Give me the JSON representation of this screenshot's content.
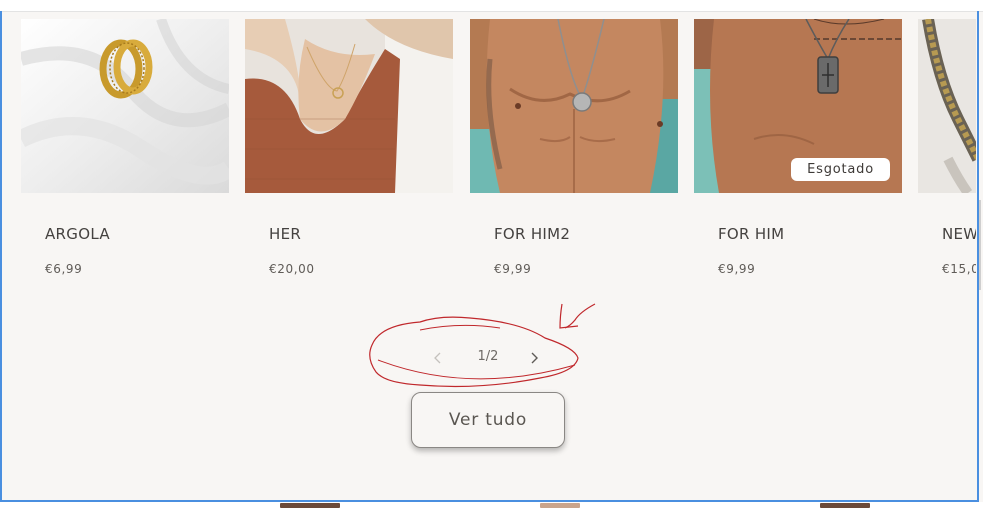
{
  "products": [
    {
      "title": "ARGOLA",
      "price": "€6,99"
    },
    {
      "title": "HER",
      "price": "€20,00"
    },
    {
      "title": "FOR HIM2",
      "price": "€9,99"
    },
    {
      "title": "FOR HIM",
      "price": "€9,99",
      "badge": "Esgotado"
    },
    {
      "title": "NEW",
      "price": "€15,0"
    }
  ],
  "pagination": {
    "current": "1/2"
  },
  "view_all": {
    "label": "Ver tudo"
  },
  "colors": {
    "background": "#f8f6f4",
    "focus_outline": "#4a8fe0",
    "annotation_ink": "#c0282c"
  }
}
